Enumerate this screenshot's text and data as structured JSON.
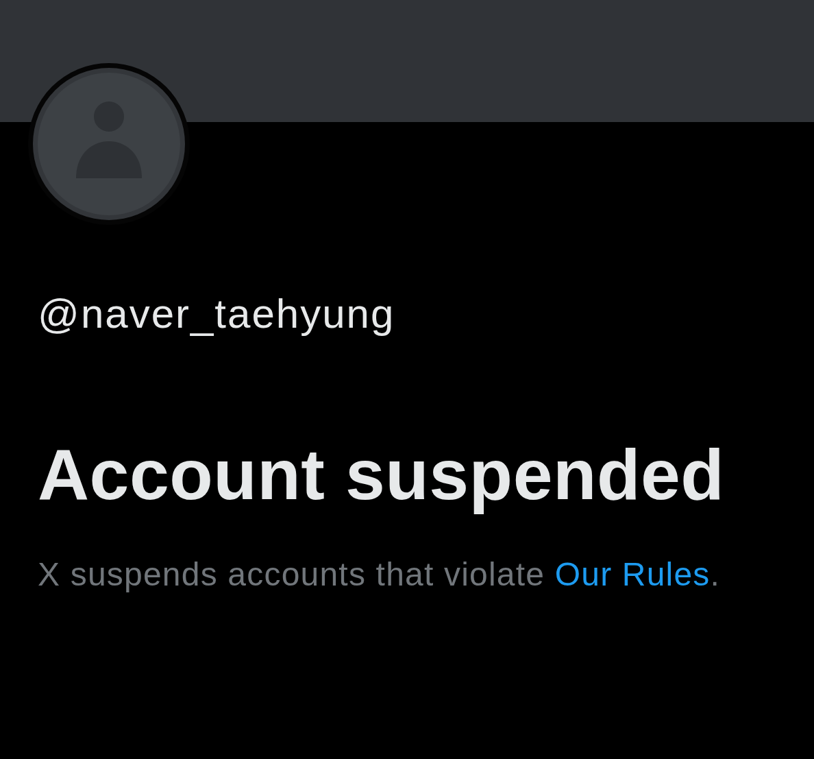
{
  "profile": {
    "handle": "@naver_taehyung"
  },
  "notice": {
    "title": "Account suspended",
    "message": {
      "before": "X suspends accounts that violate",
      "link": "Our Rules",
      "after": "."
    }
  }
}
